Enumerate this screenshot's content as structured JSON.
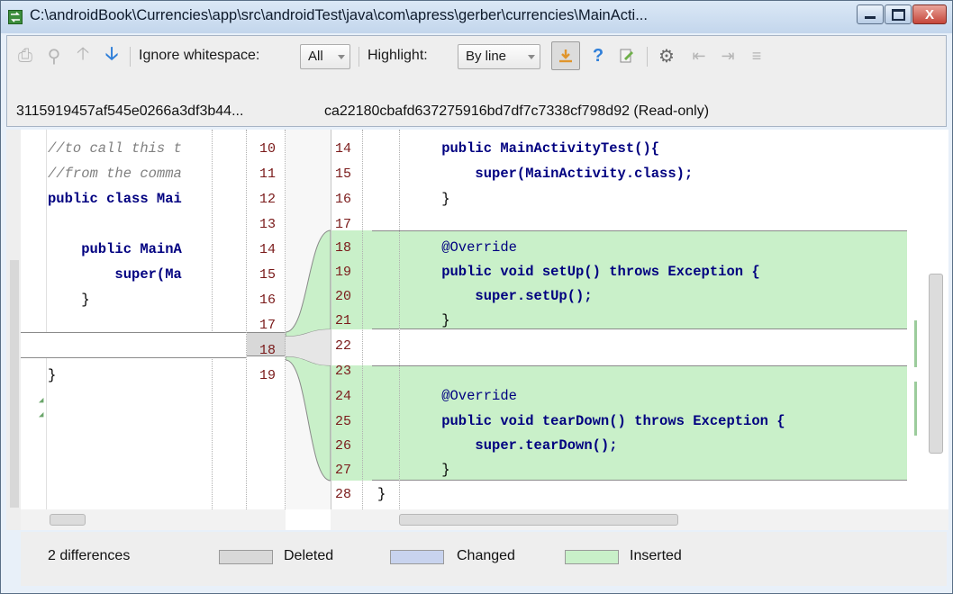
{
  "window": {
    "title": "C:\\androidBook\\Currencies\\app\\src\\androidTest\\java\\com\\apress\\gerber\\currencies\\MainActi...",
    "minimize_label": "–",
    "maximize_label": "□",
    "close_label": "X"
  },
  "toolbar": {
    "ignore_whitespace_label": "Ignore whitespace:",
    "ignore_whitespace_value": "All",
    "highlight_label": "Highlight:",
    "highlight_value": "By line",
    "help_label": "?"
  },
  "left_revision": "3115919457af545e0266a3df3b44...",
  "right_revision": "ca22180cbafd637275916bd7df7c7338cf798d92 (Read-only)",
  "left_lines": [
    "//to call this t",
    "//from the comma",
    "public class Mai",
    "",
    "    public MainA",
    "        super(Ma",
    "    }",
    "",
    "",
    "}"
  ],
  "left_numbers": [
    "10",
    "11",
    "12",
    "13",
    "14",
    "15",
    "16",
    "17",
    "18",
    "19"
  ],
  "right_numbers": [
    "14",
    "15",
    "16",
    "17",
    "18",
    "19",
    "20",
    "21",
    "22",
    "23",
    "24",
    "25",
    "26",
    "27",
    "28"
  ],
  "right_lines": [
    "    public MainActivityTest(){",
    "        super(MainActivity.class);",
    "    }",
    "",
    "    @Override",
    "    public void setUp() throws Exception {",
    "        super.setUp();",
    "    }",
    "",
    "",
    "    @Override",
    "    public void tearDown() throws Exception {",
    "        super.tearDown();",
    "    }",
    "}"
  ],
  "footer": {
    "differences": "2 differences",
    "deleted_label": "Deleted",
    "changed_label": "Changed",
    "inserted_label": "Inserted"
  },
  "colors": {
    "inserted": "#c9f0c9",
    "deleted": "#d8d8d8",
    "changed": "#c8d3ee"
  }
}
